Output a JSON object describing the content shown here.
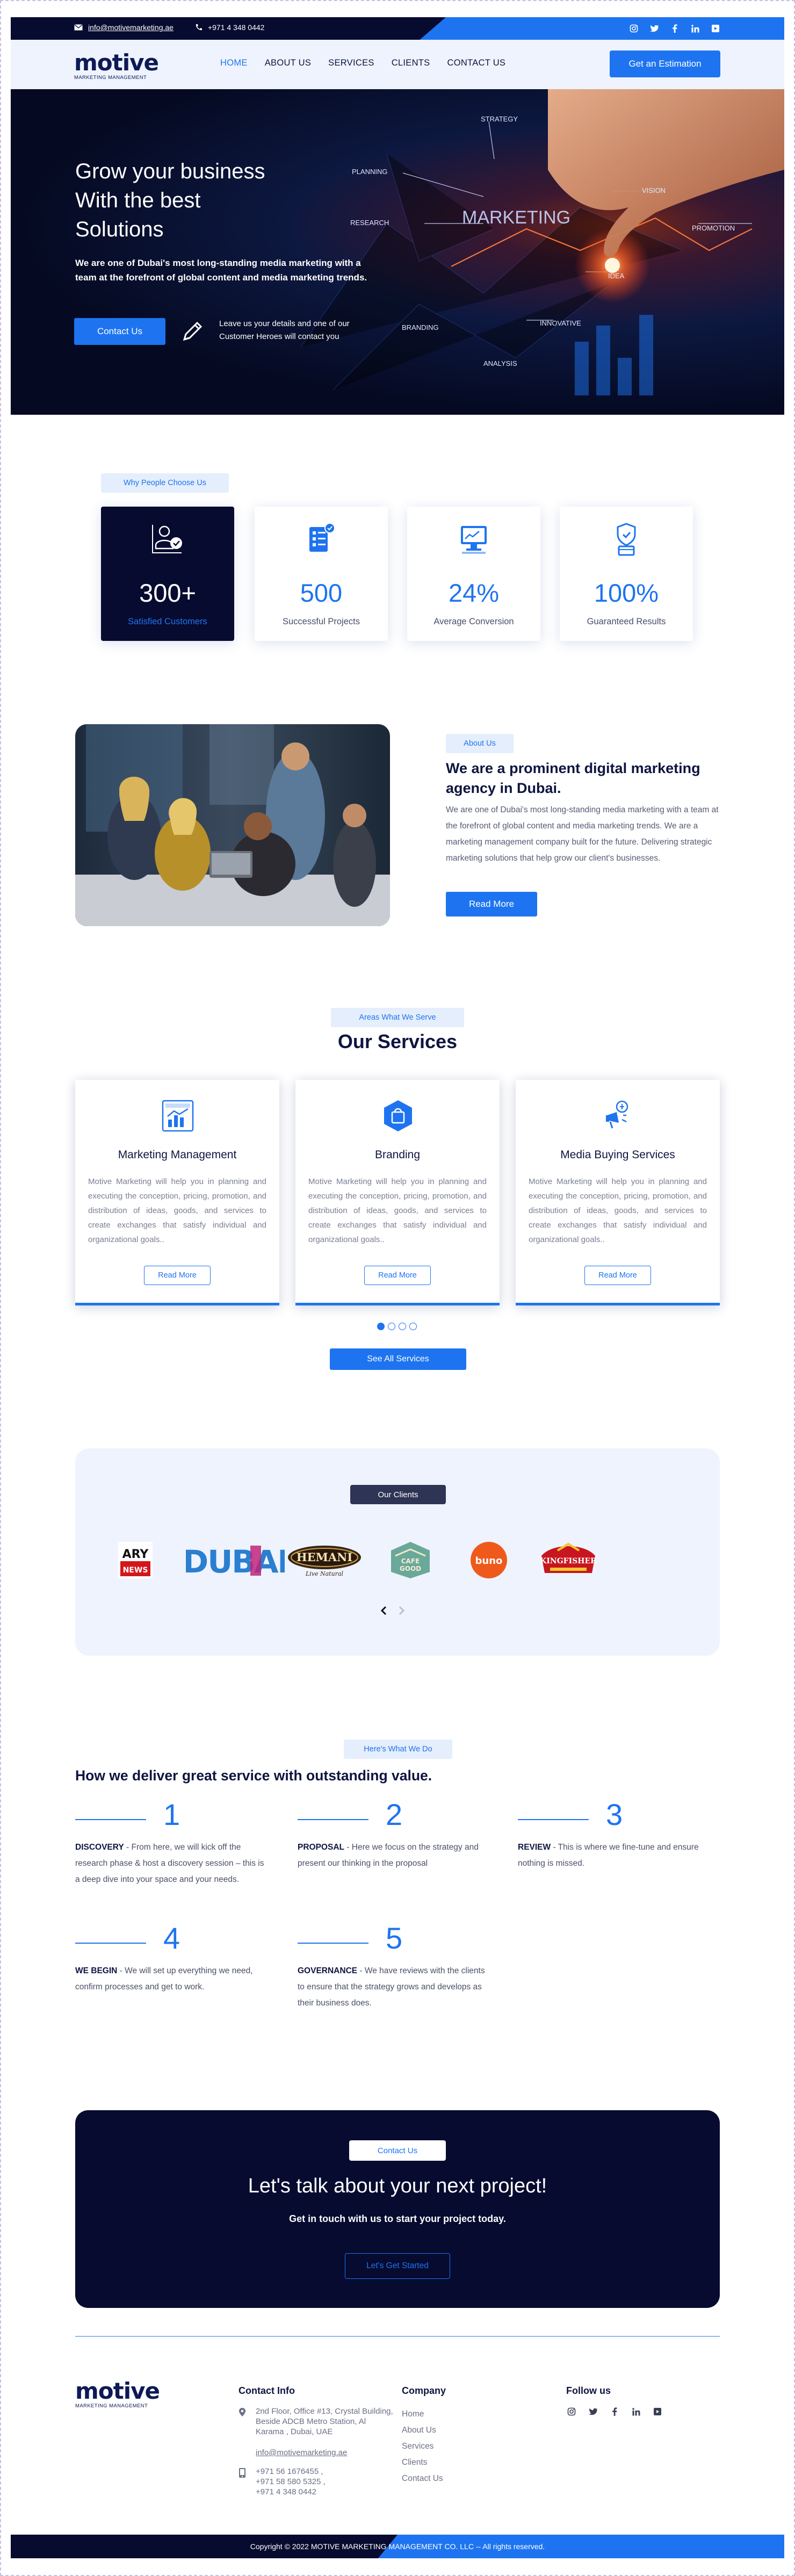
{
  "topbar": {
    "email": "info@motivemarketing.ae",
    "phone": "+971 4 348 0442",
    "socials": [
      "instagram-icon",
      "twitter-icon",
      "facebook-icon",
      "linkedin-icon",
      "youtube-icon"
    ]
  },
  "brand": {
    "logo_text": "motive",
    "logo_tagline": "MARKETING MANAGEMENT"
  },
  "nav": {
    "items": [
      "HOME",
      "ABOUT US",
      "SERVICES",
      "CLIENTS",
      "CONTACT US"
    ],
    "active": "HOME",
    "cta": "Get an Estimation"
  },
  "hero": {
    "title_lines": [
      "Grow your business",
      "With the best",
      "Solutions"
    ],
    "subtitle": "We are one of Dubai's most long-standing media marketing with a team at the forefront of global content and media marketing trends.",
    "button": "Contact Us",
    "leave_note": "Leave us your details and one of our Customer Heroes will contact you",
    "image_words": [
      "STRATEGY",
      "PLANNING",
      "RESEARCH",
      "MARKETING",
      "VISION",
      "PROMOTION",
      "IDEA",
      "BRANDING",
      "INNOVATIVE",
      "ANALYSIS"
    ]
  },
  "stats": {
    "label": "Why People Choose Us",
    "items": [
      {
        "value": "300+",
        "label": "Satisfied Customers",
        "icon": "customers-icon"
      },
      {
        "value": "500",
        "label": "Successful Projects",
        "icon": "projects-icon"
      },
      {
        "value": "24%",
        "label": "Average Conversion",
        "icon": "conversion-icon"
      },
      {
        "value": "100%",
        "label": "Guaranteed Results",
        "icon": "guarantee-icon"
      }
    ]
  },
  "about": {
    "label": "About Us",
    "heading": "We are a prominent digital marketing agency in Dubai.",
    "body": "We are one of Dubai's most long-standing media marketing with a team at the forefront of global content and media marketing trends. We are a marketing management company built for the future. Delivering strategic marketing solutions that help grow our client's businesses.",
    "button": "Read More"
  },
  "services": {
    "label": "Areas What We Serve",
    "title": "Our Services",
    "items": [
      {
        "title": "Marketing Management",
        "icon": "marketing-chart-icon",
        "text": "Motive Marketing will help you in planning and executing the conception, pricing, promotion, and distribution of ideas, goods, and services to create exchanges that satisfy individual and organizational goals..",
        "button": "Read More"
      },
      {
        "title": "Branding",
        "icon": "branding-bag-icon",
        "text": "Motive Marketing will help you in planning and executing the conception, pricing, promotion, and distribution of ideas, goods, and services to create exchanges that satisfy individual and organizational goals..",
        "button": "Read More"
      },
      {
        "title": "Media Buying Services",
        "icon": "megaphone-icon",
        "text": "Motive Marketing will help you in planning and executing the conception, pricing, promotion, and distribution of ideas, goods, and services to create exchanges that satisfy individual and organizational goals..",
        "button": "Read More"
      }
    ],
    "see_all": "See All Services"
  },
  "clients": {
    "label": "Our Clients",
    "logos": [
      {
        "name": "ARY NEWS",
        "line1": "ARY",
        "line2": "NEWS"
      },
      {
        "name": "DUBAI",
        "text": "DUBAI"
      },
      {
        "name": "HEMANI",
        "text": "HEMANI",
        "tagline": "Live Natural"
      },
      {
        "name": "CAFE GOOD",
        "line1": "CAFE",
        "line2": "GOOD"
      },
      {
        "name": "BUNO",
        "text": "buno"
      },
      {
        "name": "KINGFISHER",
        "text": "KINGFISHER"
      }
    ]
  },
  "process": {
    "label": "Here's What We Do",
    "title": "How we deliver great service with outstanding value.",
    "steps": [
      {
        "num": "1",
        "name": "DISCOVERY",
        "text": " - From here, we will kick off the research phase & host a discovery session – this is a deep dive into your space and your needs."
      },
      {
        "num": "2",
        "name": "PROPOSAL",
        "text": " - Here we focus on the strategy and present our thinking in the proposal"
      },
      {
        "num": "3",
        "name": "REVIEW",
        "text": " - This is where we fine-tune and ensure nothing is missed."
      },
      {
        "num": "4",
        "name": "WE BEGIN",
        "text": " - We will set up everything we need, confirm processes and get to work."
      },
      {
        "num": "5",
        "name": "GOVERNANCE",
        "text": " - We have reviews with the clients to ensure that the strategy grows and develops as their business does."
      }
    ]
  },
  "cta": {
    "label": "Contact Us",
    "title": "Let's talk about your next project!",
    "text": "Get in touch with us to start your project today.",
    "button": "Let's Get Started"
  },
  "footer": {
    "contact_title": "Contact Info",
    "address": "2nd Floor, Office #13, Crystal Building, Beside ADCB Metro Station, Al Karama , Dubai, UAE",
    "email": "info@motivemarketing.ae",
    "phones": [
      "+971 56 1676455 ,",
      "+971 58 580 5325 ,",
      "+971 4 348 0442"
    ],
    "company_title": "Company",
    "company_links": [
      "Home",
      "About Us",
      "Services",
      "Clients",
      "Contact Us"
    ],
    "follow_title": "Follow us",
    "copyright": "Copyright © 2022 MOTIVE MARKETING MANAGEMENT CO. LLC -- All rights reserved."
  },
  "colors": {
    "accent": "#1e74f0",
    "navy": "#070b30",
    "light_bg": "#eef3fd"
  }
}
